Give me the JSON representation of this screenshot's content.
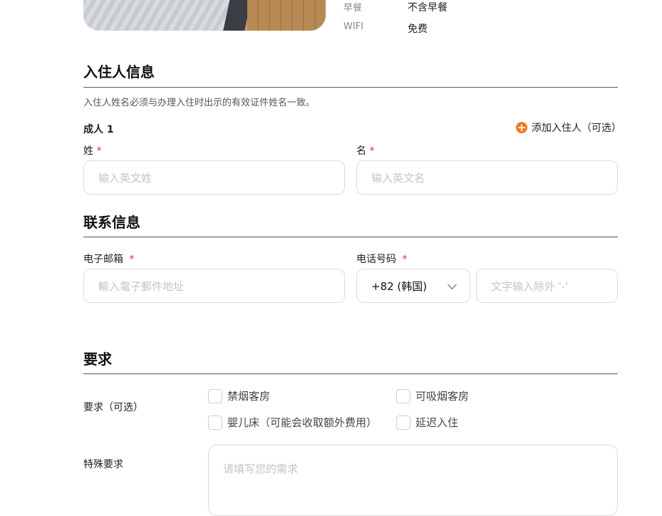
{
  "room_info": [
    {
      "label": "早餐",
      "value": "不含早餐"
    },
    {
      "label": "WIFI",
      "value": "免费"
    }
  ],
  "guest_section": {
    "title": "入住人信息",
    "note": "入住人姓名必须与办理入住时出示的有效证件姓名一致。",
    "adult_label": "成人 1",
    "add_guest_label": "添加入住人（可选）",
    "add_icon_glyph": "+",
    "last_name_label": "姓",
    "first_name_label": "名",
    "required_mark": "*",
    "last_name_placeholder": "输入英文姓",
    "first_name_placeholder": "输入英文名"
  },
  "contact_section": {
    "title": "联系信息",
    "email_label": "电子邮箱",
    "phone_label": "电话号码",
    "required_mark": "*",
    "email_placeholder": "輸入電子郵件地址",
    "country_code_value": "+82 (韩国)",
    "phone_placeholder": "文字输入除外 '-'"
  },
  "requests_section": {
    "title": "要求",
    "optional_label": "要求（可选）",
    "options": [
      {
        "label": "禁烟客房",
        "checked": false
      },
      {
        "label": "可吸烟客房",
        "checked": false
      },
      {
        "label": "婴儿床（可能会收取额外费用）",
        "checked": false
      },
      {
        "label": "延迟入住",
        "checked": false
      }
    ],
    "special_label": "特殊要求",
    "special_placeholder": "请填写您的需求"
  },
  "colors": {
    "accent": "#f07a1a",
    "required": "#e0342b",
    "border": "#dcdcdc"
  }
}
